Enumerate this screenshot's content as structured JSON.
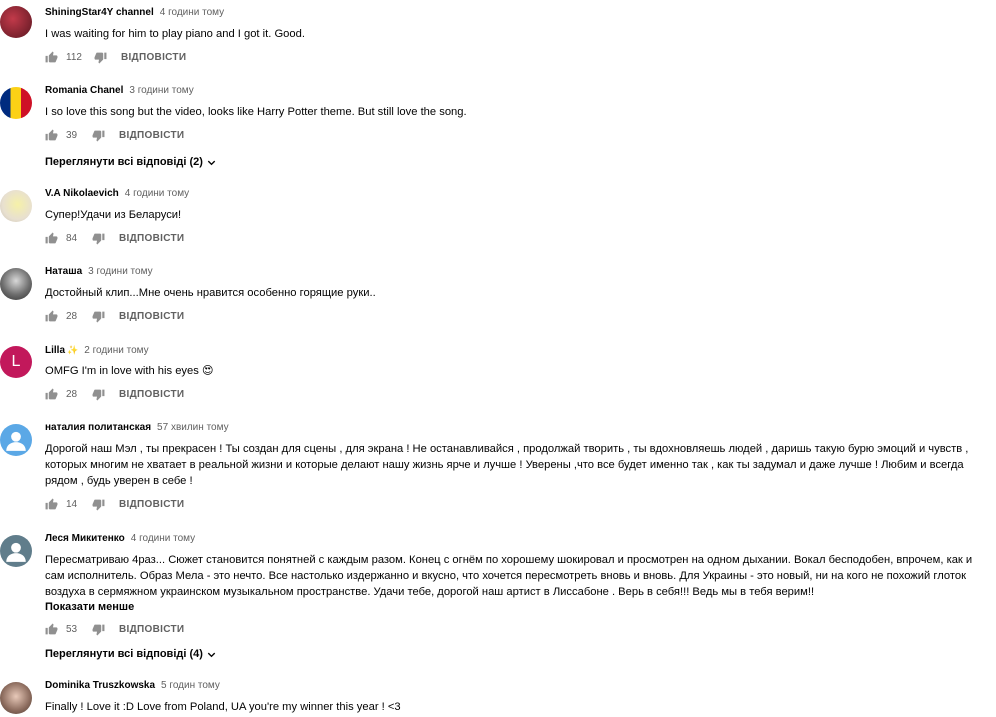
{
  "reply_label": "ВІДПОВІСТИ",
  "comments": [
    {
      "author": "ShiningStar4Y channel",
      "time": "4 години тому",
      "text": "I was waiting for him to play piano and I got it. Good.",
      "likes": "112"
    },
    {
      "author": "Romania Chanel",
      "time": "3 години тому",
      "text": "I so love this song but the video, looks like Harry Potter theme. But still love the song.",
      "likes": "39",
      "view_replies": "Переглянути всі відповіді (2)"
    },
    {
      "author": "V.A Nikolaevich",
      "time": "4 години тому",
      "text": "Супер!Удачи из Беларуси!",
      "likes": "84"
    },
    {
      "author": "Наташа",
      "time": "3 години тому",
      "text": "Достойный клип...Мне очень нравится особенно горящие руки..",
      "likes": "28"
    },
    {
      "author": "Lilla",
      "author_badge": "✨",
      "time": "2 години тому",
      "text": "OMFG I'm in love with his eyes 😍",
      "likes": "28",
      "avatar_letter": "L"
    },
    {
      "author": "наталия политанская",
      "time": "57 хвилин тому",
      "text": "Дорогой наш Мэл , ты прекрасен ! Ты создан для сцены , для экрана ! Не останавливайся , продолжай творить , ты вдохновляешь людей , даришь такую бурю эмоций и чувств , которых многим не хватает  в реальной жизни и которые делают нашу жизнь ярче и лучше  !  Уверены ,что все будет именно так , как ты задумал и даже лучше ! Любим и всегда рядом , будь уверен в себе !",
      "likes": "14"
    },
    {
      "author": "Леся Микитенко",
      "time": "4 години тому",
      "text": "Пересматриваю 4раз... Сюжет становится понятней с каждым разом. Конец с огнём по хорошему шокировал и просмотрен на одном дыхании. Вокал бесподобен, впрочем, как и сам исполнитель. Образ Мела  - это нечто. Все настолько издержанно и вкусно, что хочется пересмотреть вновь и вновь. Для Украины - это новый, ни на кого не похожий глоток воздуха в сермяжном украинском музыкальном пространстве. Удачи тебе, дорогой наш артист в Лиссабоне . Верь в себя!!! Ведь мы в тебя верим!!",
      "show_less": "Показати менше",
      "likes": "53",
      "view_replies": "Переглянути всі відповіді (4)"
    },
    {
      "author": "Dominika Truszkowska",
      "time": "5 годин тому",
      "text": "Finally ! Love it :D Love from Poland, UA you're my winner this year ! <3",
      "likes": ""
    }
  ]
}
